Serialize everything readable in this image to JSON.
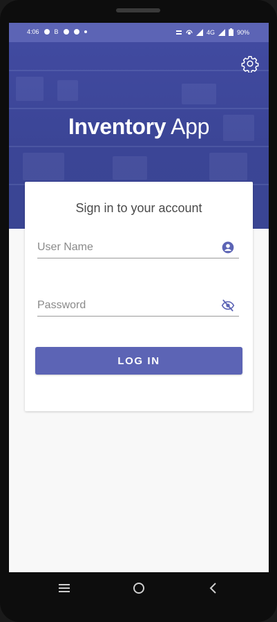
{
  "status_bar": {
    "time": "4:06",
    "network": "4G",
    "battery": "90%",
    "icons": [
      "chat-bubble-icon",
      "b-icon",
      "messenger-icon",
      "message-icon",
      "dot-icon",
      "data-speed-icon",
      "hotspot-icon",
      "signal-icon",
      "4g-signal-icon",
      "battery-icon"
    ]
  },
  "header": {
    "title_bold": "Inventory",
    "title_light": "App",
    "settings_icon": "gear-icon"
  },
  "login_card": {
    "title": "Sign in to your account",
    "username_placeholder": "User Name",
    "username_value": "",
    "username_icon": "account-circle-icon",
    "password_placeholder": "Password",
    "password_value": "",
    "password_icon": "eye-off-icon",
    "login_label": "LOG IN"
  },
  "navigation": {
    "recent_apps_icon": "menu-lines-icon",
    "home_icon": "circle-home-icon",
    "back_icon": "chevron-left-icon"
  },
  "colors": {
    "accent": "#5c64b5",
    "header_bg": "#3b4596",
    "card_bg": "#ffffff",
    "screen_bg": "#f8f8f8",
    "icon_color": "#5c64b5"
  }
}
